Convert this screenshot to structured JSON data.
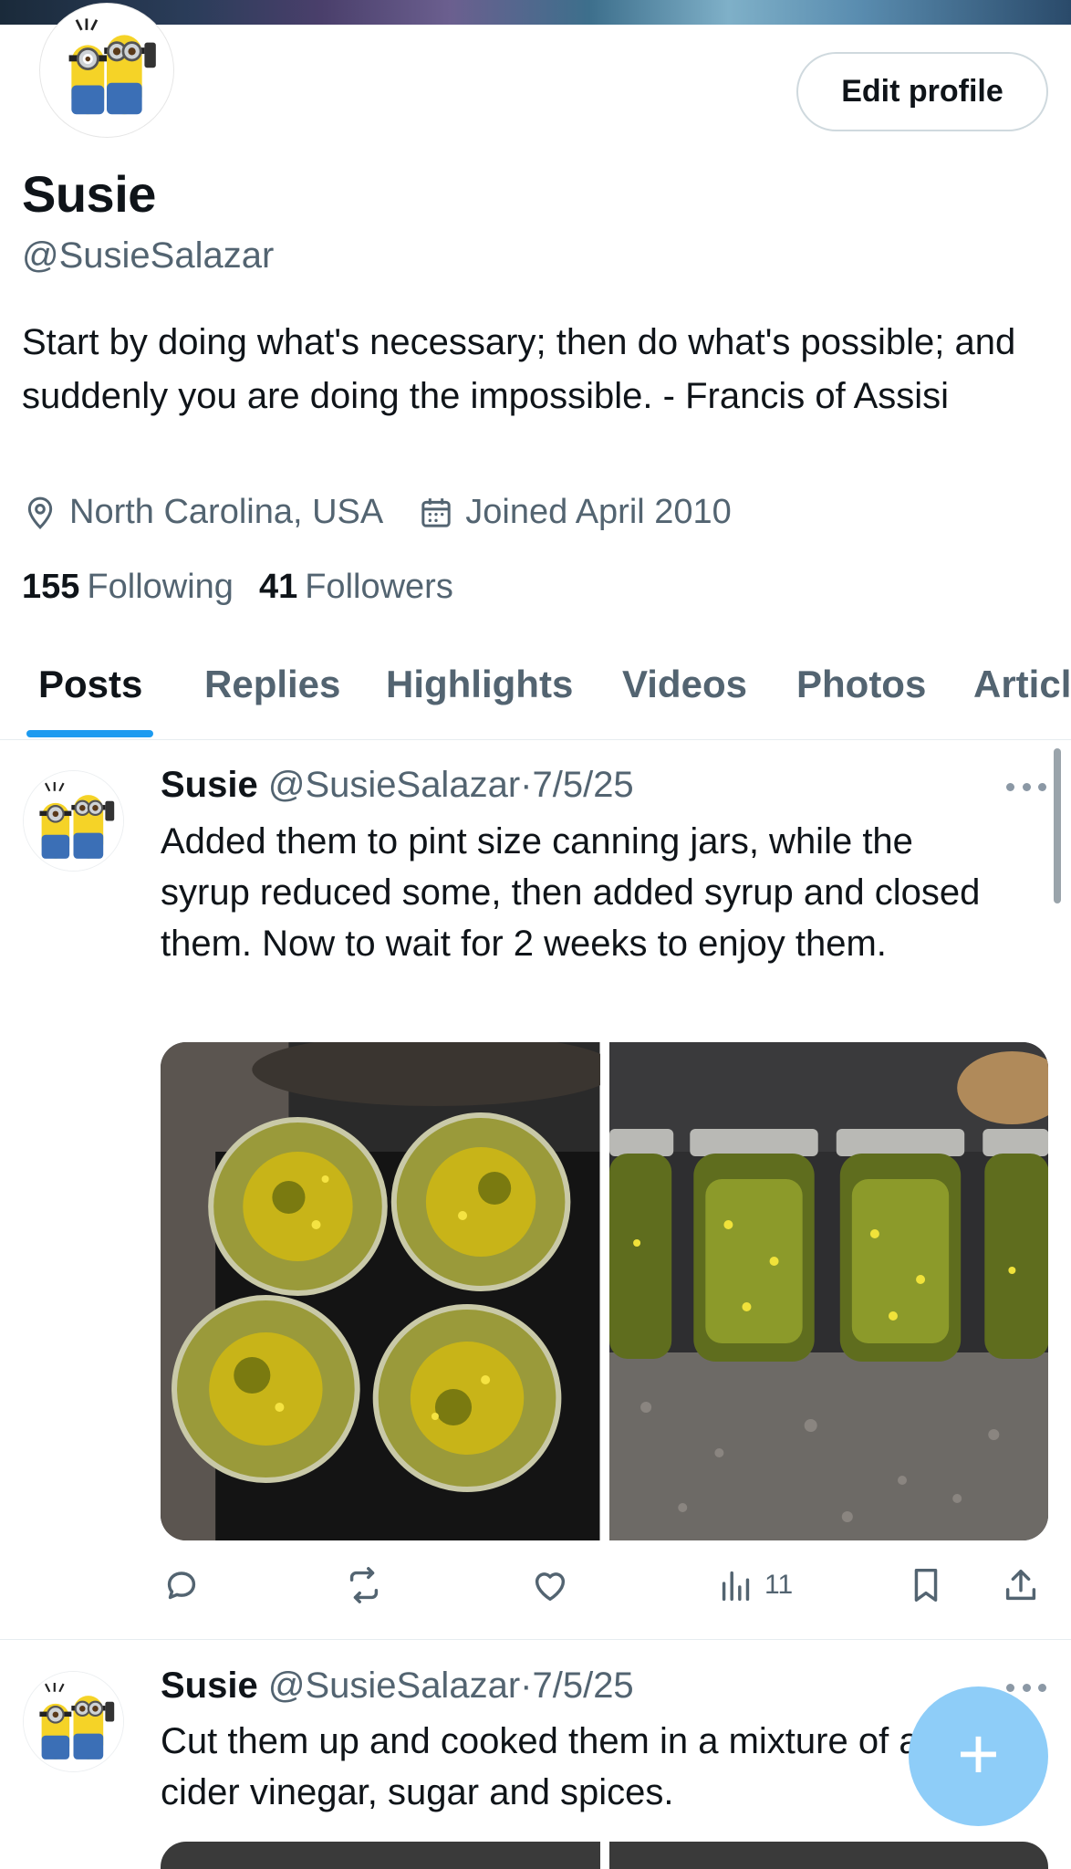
{
  "profile": {
    "name": "Susie",
    "handle": "@SusieSalazar",
    "bio": "Start by doing what's necessary; then do what's possible; and suddenly you are doing the impossible. - Francis of Assisi",
    "location": "North Carolina, USA",
    "joined": "Joined April 2010",
    "following_count": "155",
    "following_label": "Following",
    "followers_count": "41",
    "followers_label": "Followers",
    "edit_label": "Edit profile",
    "avatar_icon": "minions-avatar"
  },
  "tabs": [
    {
      "label": "Posts",
      "active": true
    },
    {
      "label": "Replies"
    },
    {
      "label": "Highlights"
    },
    {
      "label": "Videos"
    },
    {
      "label": "Photos"
    },
    {
      "label": "Articles"
    }
  ],
  "tweets": [
    {
      "name": "Susie",
      "handle": "@SusieSalazar",
      "sep": "·",
      "date": "7/5/25",
      "text": "Added them to pint size canning jars, while the syrup reduced some, then added syrup and closed them.  Now to wait for 2 weeks to enjoy them.",
      "views": "11",
      "media": [
        "jars-top-view-photo",
        "jars-side-view-photo"
      ]
    },
    {
      "name": "Susie",
      "handle": "@SusieSalazar",
      "sep": "·",
      "date": "7/5/25",
      "text": "Cut them up and cooked them in a mixture of apple cider vinegar, sugar and spices."
    }
  ],
  "fab": {
    "label": "+",
    "icon": "compose-plus-icon"
  },
  "colors": {
    "accent": "#1d9bf0",
    "fab": "#8ecdf8",
    "secondary_text": "#536471"
  }
}
